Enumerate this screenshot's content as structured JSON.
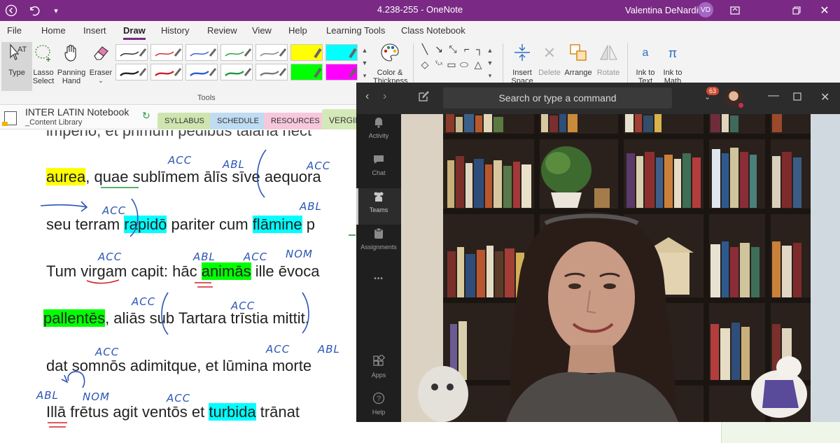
{
  "titlebar": {
    "title": "4.238-255  -  OneNote",
    "user": "Valentina DeNardis",
    "avatar_initials": "VD",
    "accent": "#7a2a85"
  },
  "menu": [
    "File",
    "Home",
    "Insert",
    "Draw",
    "History",
    "Review",
    "View",
    "Help",
    "Learning Tools",
    "Class Notebook"
  ],
  "menu_active": "Draw",
  "ribbon": {
    "type": "Type",
    "lasso1": "Lasso",
    "lasso2": "Select",
    "pan1": "Panning",
    "pan2": "Hand",
    "eraser": "Eraser",
    "tools_label": "Tools",
    "color1": "Color &",
    "color2": "Thickness",
    "insert1": "Insert",
    "insert2": "Space",
    "delete": "Delete",
    "arrange": "Arrange",
    "rotate": "Rotate",
    "ink_text1": "Ink to",
    "ink_text2": "Text",
    "ink_math1": "Ink to",
    "ink_math2": "Math",
    "pen_colors": [
      "#222222",
      "#d0202a",
      "#2a5bd7",
      "#1f9a3a",
      "#7a7a7a",
      "#ffff00",
      "#222222",
      "#d0202a",
      "#2a5bd7",
      "#1f9a3a",
      "#7a7a7a",
      "#00ff00",
      "#00ffff",
      "#ff00ff"
    ]
  },
  "notebook": {
    "title": "INTER LATIN Notebook",
    "subtitle": "_Content Library",
    "tabs": [
      {
        "label": "SYLLABUS",
        "color": "#cfe5b0"
      },
      {
        "label": "SCHEDULE",
        "color": "#bfdcf2"
      },
      {
        "label": "RESOURCES",
        "color": "#f7c7dc"
      },
      {
        "label": "VERGIL",
        "color": "#d4e9b8"
      }
    ]
  },
  "page": {
    "l0": "imperio, et primum pedibus tālāria nect",
    "l1a": "aurea",
    "l1b": ", ",
    "l1c": "quae",
    "l1d": " sublīmem ālīs sīve aequora",
    "l2a": "seu terram ",
    "l2b": "rapidō",
    "l2c": " pariter cum ",
    "l2d": "flāmine",
    "l2e": " p",
    "l3a": "Tum virgam capit: hāc ",
    "l3b": "animās",
    "l3c": " ille ēvoca",
    "l4a": "pallentēs",
    "l4b": ", aliās sub Tartara trīstia mittit,",
    "l5": "dat somnōs adimitque, et lūmina morte",
    "l6a": "Illā frētus agit ventōs et ",
    "l6b": "turbida",
    "l6c": " trānat",
    "annotations": {
      "acc": "ACC",
      "abl": "ABL",
      "nom": "NOM"
    }
  },
  "teams": {
    "search_placeholder": "Search or type a command",
    "badge": "63",
    "rail": [
      "Activity",
      "Chat",
      "Teams",
      "Assignments",
      "Apps",
      "Help"
    ],
    "rail_active": "Teams",
    "more": "•••"
  }
}
